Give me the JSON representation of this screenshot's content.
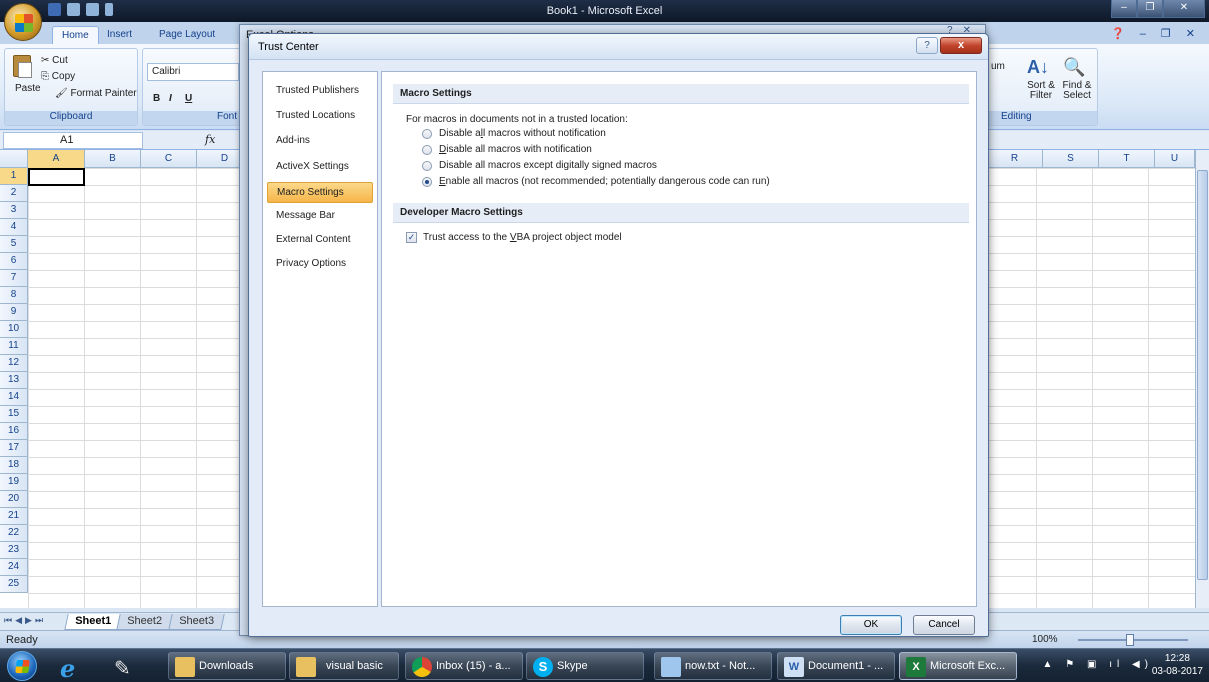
{
  "excel": {
    "window_title": "Book1 - Microsoft Excel",
    "ribbon_tabs": [
      "Home",
      "Insert",
      "Page Layout"
    ],
    "clipboard": {
      "cut": "Cut",
      "copy": "Copy",
      "format_painter": "Format Painter",
      "paste": "Paste",
      "group_label": "Clipboard"
    },
    "font": {
      "name": "Calibri",
      "group_label": "Font",
      "bold": "B",
      "italic": "I",
      "underline": "U"
    },
    "editing": {
      "autosum_tail": "um",
      "sort_filter": "Sort & Filter",
      "find_select": "Find & Select",
      "group_label": "Editing"
    },
    "name_box": "A1",
    "fx": "fx",
    "columns_left": [
      "A",
      "B",
      "C",
      "D"
    ],
    "columns_right": [
      "R",
      "S",
      "T",
      "U"
    ],
    "rows": [
      "1",
      "2",
      "3",
      "4",
      "5",
      "6",
      "7",
      "8",
      "9",
      "10",
      "11",
      "12",
      "13",
      "14",
      "15",
      "16",
      "17",
      "18",
      "19",
      "20",
      "21",
      "22",
      "23",
      "24",
      "25"
    ],
    "sheets": [
      "Sheet1",
      "Sheet2",
      "Sheet3"
    ],
    "status": "Ready",
    "zoom": "100%"
  },
  "excel_options": {
    "title": "Excel Options"
  },
  "dialog": {
    "title": "Trust Center",
    "help": "?",
    "close": "x",
    "nav": [
      "Trusted Publishers",
      "Trusted Locations",
      "Add-ins",
      "ActiveX Settings",
      "Macro Settings",
      "Message Bar",
      "External Content",
      "Privacy Options"
    ],
    "selected_nav": "Macro Settings",
    "macro_section": "Macro Settings",
    "intro": "For macros in documents not in a trusted location:",
    "radios": [
      {
        "pre": "Disable a",
        "acc": "l",
        "post": "l macros without notification",
        "selected": false
      },
      {
        "pre": "",
        "acc": "D",
        "post": "isable all macros with notification",
        "selected": false
      },
      {
        "pre": "Disable all macros except di",
        "acc": "g",
        "post": "itally signed macros",
        "selected": false
      },
      {
        "pre": "",
        "acc": "E",
        "post": "nable all macros (not recommended; potentially dangerous code can run)",
        "selected": true
      }
    ],
    "dev_section": "Developer Macro Settings",
    "trust_vba": {
      "pre": "Trust access to the ",
      "acc": "V",
      "post": "BA project object model",
      "checked": true
    },
    "ok": "OK",
    "cancel": "Cancel"
  },
  "taskbar": {
    "items": [
      "Downloads",
      "visual basic",
      "Inbox (15) - a...",
      "Skype",
      "now.txt - Not...",
      "Document1 - ...",
      "Microsoft Exc..."
    ],
    "time": "12:28",
    "date": "03-08-2017"
  },
  "colors": {
    "accent_selected": "#f6b54a",
    "excel_green": "#1d7a3a",
    "skype_blue": "#00aff0"
  }
}
